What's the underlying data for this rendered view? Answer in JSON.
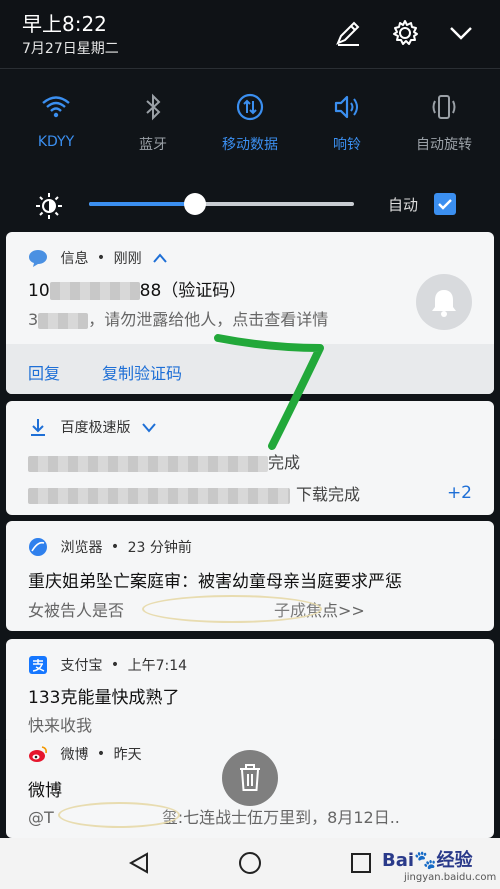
{
  "status": {
    "time": "早上8:22",
    "date": "7月27日星期二"
  },
  "quick_settings": [
    {
      "label": "KDYY",
      "icon": "wifi-icon",
      "active": true
    },
    {
      "label": "蓝牙",
      "icon": "bluetooth-icon",
      "active": false
    },
    {
      "label": "移动数据",
      "icon": "mobile-data-icon",
      "active": true
    },
    {
      "label": "响铃",
      "icon": "ring-icon",
      "active": true
    },
    {
      "label": "自动旋转",
      "icon": "auto-rotate-icon",
      "active": false
    }
  ],
  "brightness": {
    "level": 0.4,
    "auto_label": "自动",
    "auto_checked": true
  },
  "notifications": {
    "message": {
      "app": "信息",
      "time": "刚刚",
      "title_start": "10",
      "title_end": "88（验证码）",
      "body_start": "3",
      "body_end": "，请勿泄露给他人，点击查看详情",
      "action_reply": "回复",
      "action_copy": "复制验证码"
    },
    "baidu": {
      "app": "百度极速版",
      "line1_end": "完成",
      "line2_end": "下载完成",
      "more": "+2"
    },
    "browser": {
      "app": "浏览器",
      "time": "23 分钟前",
      "title": "重庆姐弟坠亡案庭审：被害幼童母亲当庭要求严惩",
      "body_start": "女被告人是否",
      "body_end": "子成焦点>>"
    },
    "alipay": {
      "app": "支付宝",
      "time": "上午7:14",
      "title": "133克能量快成熟了",
      "body": "快来收我"
    },
    "weibo": {
      "app": "微博",
      "time": "昨天",
      "title": "微博",
      "body_start": "@T",
      "body_end": "玺:七连战士伍万里到，8月12日.."
    }
  },
  "separator": "•",
  "watermark": {
    "text": "Bai🐾经验",
    "sub": "jingyan.baidu.com"
  },
  "colors": {
    "accent": "#3b8ff0",
    "link": "#1e6fd6",
    "annotation_stroke": "#22a83a"
  }
}
